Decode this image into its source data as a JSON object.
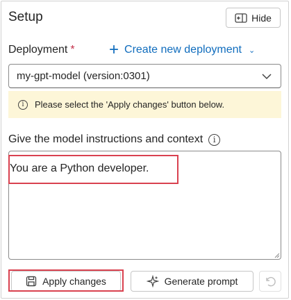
{
  "panel": {
    "title": "Setup",
    "hide_label": "Hide"
  },
  "deployment": {
    "label": "Deployment",
    "required_mark": "*",
    "create_label": "Create new deployment",
    "selected": "my-gpt-model (version:0301)"
  },
  "notice": {
    "text": "Please select the 'Apply changes' button below."
  },
  "instructions": {
    "label": "Give the model instructions and context",
    "value": "You are a Python developer."
  },
  "actions": {
    "apply_label": "Apply changes",
    "generate_label": "Generate prompt"
  },
  "colors": {
    "accent": "#0f6cbd",
    "highlight": "#d9414f",
    "notice_bg": "#fdf6d8",
    "required": "#c4314b"
  }
}
